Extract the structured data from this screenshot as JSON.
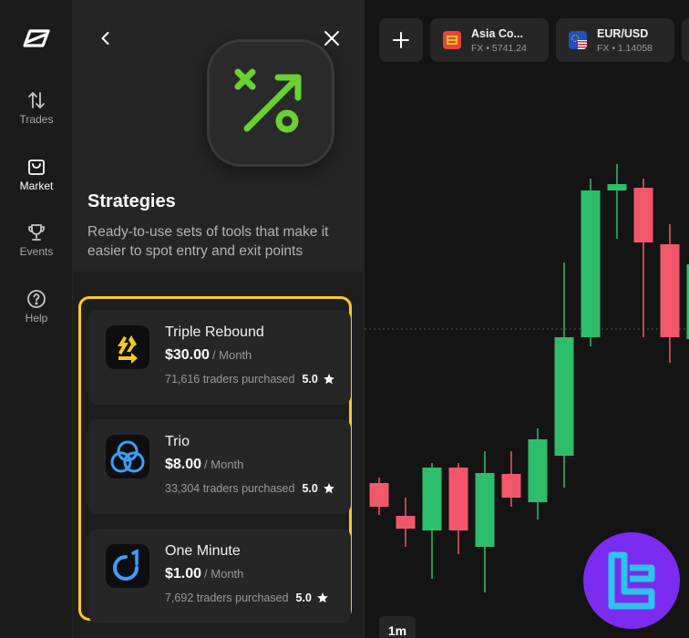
{
  "rail": {
    "items": [
      {
        "label": "Trades",
        "icon": "arrows-updown-icon"
      },
      {
        "label": "Market",
        "icon": "shopping-bag-icon",
        "active": true
      },
      {
        "label": "Events",
        "icon": "trophy-icon"
      },
      {
        "label": "Help",
        "icon": "help-circle-icon"
      }
    ]
  },
  "panel": {
    "title": "Strategies",
    "description": "Ready-to-use sets of tools that make it easier to spot entry and exit points",
    "strategies": [
      {
        "name": "Triple Rebound",
        "price": "$30.00",
        "period": "/ Month",
        "purchased": "71,616 traders purchased",
        "rating": "5.0",
        "icon": "recycle-icon"
      },
      {
        "name": "Trio",
        "price": "$8.00",
        "period": "/ Month",
        "purchased": "33,304 traders purchased",
        "rating": "5.0",
        "icon": "three-circles-icon"
      },
      {
        "name": "One Minute",
        "price": "$1.00",
        "period": "/ Month",
        "purchased": "7,692 traders purchased",
        "rating": "5.0",
        "icon": "one-minute-icon"
      }
    ]
  },
  "assets": [
    {
      "name": "Asia Co...",
      "sub": "FX • 5741.24",
      "icon": "asia-flag-icon"
    },
    {
      "name": "EUR/USD",
      "sub": "FX • 1.14058",
      "icon": "eur-usd-flag-icon"
    }
  ],
  "timeframe": "1m",
  "colors": {
    "accent": "#f5cc1d",
    "up": "#2ebd6b",
    "down": "#f0586a",
    "icon_green": "#6ad133"
  },
  "chart_data": {
    "type": "candlestick",
    "candles": [
      {
        "dir": "down",
        "open": 530,
        "close": 556,
        "high": 524,
        "low": 565
      },
      {
        "dir": "down",
        "open": 566,
        "close": 580,
        "high": 546,
        "low": 600
      },
      {
        "dir": "up",
        "open": 582,
        "close": 513,
        "high": 508,
        "low": 635
      },
      {
        "dir": "down",
        "open": 513,
        "close": 582,
        "high": 508,
        "low": 608
      },
      {
        "dir": "up",
        "open": 600,
        "close": 519,
        "high": 495,
        "low": 650
      },
      {
        "dir": "down",
        "open": 520,
        "close": 546,
        "high": 495,
        "low": 556
      },
      {
        "dir": "up",
        "open": 551,
        "close": 482,
        "high": 470,
        "low": 570
      },
      {
        "dir": "up",
        "open": 500,
        "close": 370,
        "high": 288,
        "low": 535
      },
      {
        "dir": "up",
        "open": 370,
        "close": 209,
        "high": 196,
        "low": 380
      },
      {
        "dir": "up",
        "open": 209,
        "close": 202,
        "high": 180,
        "low": 262
      },
      {
        "dir": "down",
        "open": 206,
        "close": 266,
        "high": 196,
        "low": 370
      },
      {
        "dir": "down",
        "open": 268,
        "close": 370,
        "high": 246,
        "low": 398
      },
      {
        "dir": "up",
        "open": 372,
        "close": 290,
        "high": 270,
        "low": 400
      }
    ]
  }
}
